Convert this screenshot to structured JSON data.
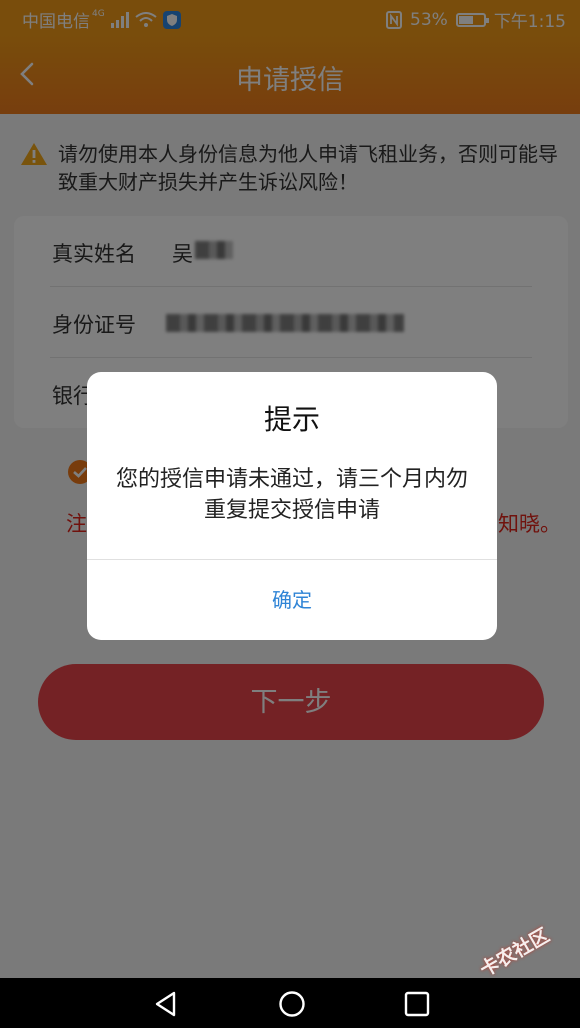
{
  "status_bar": {
    "carrier": "中国电信",
    "network": "4G",
    "battery_text": "53%",
    "time": "下午1:15"
  },
  "nav": {
    "title": "申请授信",
    "back_icon": "chevron-left-icon"
  },
  "warning": {
    "text": "请勿使用本人身份信息为他人申请飞租业务，否则可能导致重大财产损失并产生诉讼风险！",
    "icon": "warning-triangle-icon"
  },
  "form": {
    "name_label": "真实姓名",
    "name_value": "吴",
    "id_label": "身份证号",
    "bank_label": "银行"
  },
  "notice": {
    "left_text": "注",
    "right_text": "知晓。"
  },
  "next_button": "下一步",
  "dialog": {
    "title": "提示",
    "message": "您的授信申请未通过，请三个月内勿重复提交授信申请",
    "confirm": "确定"
  },
  "watermark": "卡农社区",
  "colors": {
    "brand_orange": "#f29a18",
    "button_red": "#e8454a",
    "link_blue": "#2f84d6",
    "notice_red": "#e1251b"
  }
}
